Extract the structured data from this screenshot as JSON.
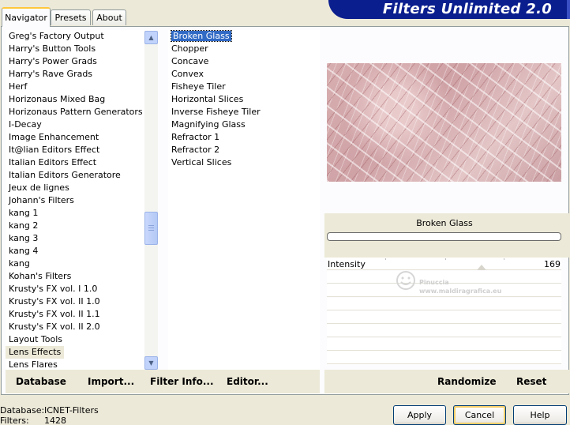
{
  "tabs": [
    {
      "label": "Navigator",
      "active": true
    },
    {
      "label": "Presets",
      "active": false
    },
    {
      "label": "About",
      "active": false
    }
  ],
  "banner": {
    "title": "Filters Unlimited 2.0"
  },
  "categories": {
    "items": [
      "Greg's Factory Output",
      "Harry's Button Tools",
      "Harry's Power Grads",
      "Harry's Rave Grads",
      "Herf",
      "Horizonaus Mixed Bag",
      "Horizonaus Pattern Generators",
      "I-Decay",
      "Image Enhancement",
      "It@lian Editors Effect",
      "Italian Editors Effect",
      "Italian Editors Generatore",
      "Jeux de lignes",
      "Johann's Filters",
      "kang 1",
      "kang 2",
      "kang 3",
      "kang 4",
      "kang",
      "Kohan's Filters",
      "Krusty's FX vol. I 1.0",
      "Krusty's FX vol. II 1.0",
      "Krusty's FX vol. II 1.1",
      "Krusty's FX vol. II 2.0",
      "Layout Tools",
      "Lens Effects",
      "Lens Flares"
    ],
    "highlighted": "Lens Effects"
  },
  "filters": {
    "items": [
      "Broken Glass",
      "Chopper",
      "Concave",
      "Convex",
      "Fisheye Tiler",
      "Horizontal Slices",
      "Inverse Fisheye Tiler",
      "Magnifying Glass",
      "Refractor 1",
      "Refractor 2",
      "Vertical Slices"
    ],
    "selected": "Broken Glass"
  },
  "toolbar": {
    "database": "Database",
    "import": "Import...",
    "filter_info": "Filter Info...",
    "editor": "Editor...",
    "randomize": "Randomize",
    "reset": "Reset"
  },
  "filter_panel": {
    "name": "Broken Glass",
    "param_label": "Intensity",
    "param_value": "169"
  },
  "watermark": {
    "line1": "Pinuccia",
    "line2": "www.maldiragrafica.eu"
  },
  "footer": {
    "database_label": "Database:",
    "database_value": "ICNET-Filters",
    "filters_label": "Filters:",
    "filters_value": "1428"
  },
  "buttons": {
    "apply": "Apply",
    "cancel": "Cancel",
    "help": "Help"
  },
  "colors": {
    "banner": "#0b1e8e",
    "selection": "#316ac5",
    "focus": "#f7cf6a"
  }
}
